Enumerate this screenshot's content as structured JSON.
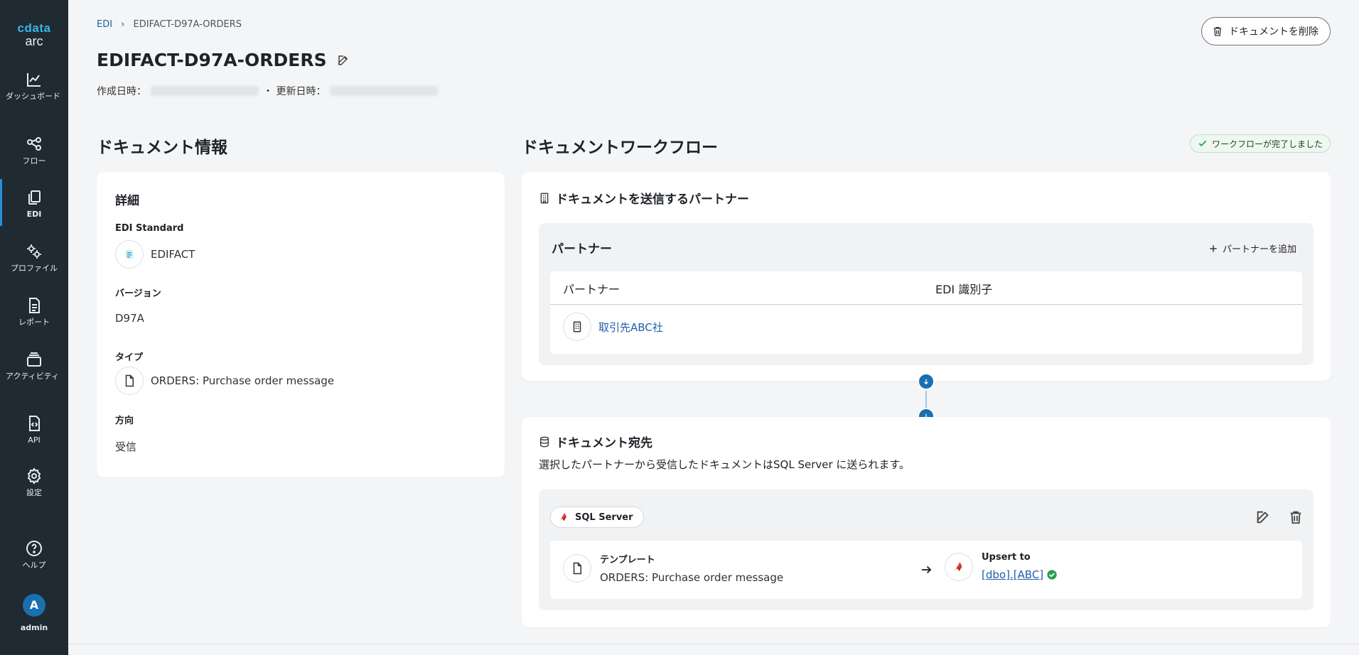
{
  "brand": {
    "name_top": "cdata",
    "name_bottom": "arc"
  },
  "sidebar": {
    "items": [
      {
        "label": "ダッシュボード",
        "icon": "chart-line-icon"
      },
      {
        "label": "フロー",
        "icon": "share-nodes-icon"
      },
      {
        "label": "EDI",
        "icon": "copy-docs-icon"
      },
      {
        "label": "プロファイル",
        "icon": "gears-icon"
      },
      {
        "label": "レポート",
        "icon": "document-lines-icon"
      },
      {
        "label": "アクティビティ",
        "icon": "layers-icon"
      },
      {
        "label": "API",
        "icon": "file-code-icon"
      },
      {
        "label": "設定",
        "icon": "gear-icon"
      },
      {
        "label": "ヘルプ",
        "icon": "help-circle-icon"
      }
    ],
    "user": {
      "initial": "A",
      "name": "admin"
    }
  },
  "breadcrumb": {
    "root": "EDI",
    "separator": "›",
    "current": "EDIFACT-D97A-ORDERS"
  },
  "header": {
    "title": "EDIFACT-D97A-ORDERS",
    "created_label": "作成日時：",
    "updated_label": "・ 更新日時：",
    "delete_button": "ドキュメントを削除"
  },
  "info": {
    "section_title": "ドキュメント情報",
    "card_title": "詳細",
    "standard_label": "EDI Standard",
    "standard_value": "EDIFACT",
    "version_label": "バージョン",
    "version_value": "D97A",
    "type_label": "タイプ",
    "type_value": "ORDERS: Purchase order message",
    "direction_label": "方向",
    "direction_value": "受信"
  },
  "workflow": {
    "section_title": "ドキュメントワークフロー",
    "status_badge": "ワークフローが完了しました",
    "sender": {
      "title": "ドキュメントを送信するパートナー",
      "panel_title": "パートナー",
      "add_button": "パートナーを追加",
      "columns": [
        "パートナー",
        "EDI 識別子"
      ],
      "rows": [
        {
          "partner": "取引先ABC社",
          "edi_id": ""
        }
      ]
    },
    "destination": {
      "title": "ドキュメント宛先",
      "description": "選択したパートナーから受信したドキュメントはSQL Server に送られます。",
      "connector": "SQL Server",
      "template_label": "テンプレート",
      "template_value": "ORDERS: Purchase order message",
      "upsert_label": "Upsert to",
      "upsert_table": "[dbo].[ABC]"
    }
  },
  "colors": {
    "accent": "#1a6fb0",
    "sidebar_bg": "#1f2a33",
    "link": "#1f5fa8",
    "success": "#2e9d4f"
  }
}
